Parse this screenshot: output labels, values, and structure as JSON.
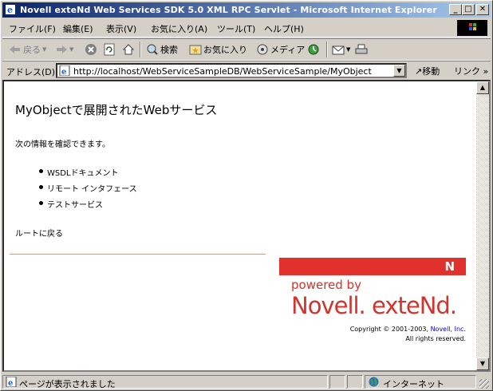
{
  "window": {
    "title": "Novell exteNd Web Services SDK 5.0 XML RPC Servlet - Microsoft Internet Explorer",
    "minimize_glyph": "_",
    "maximize_glyph": "□",
    "close_glyph": "✕"
  },
  "menu": {
    "items": [
      "ファイル(F)",
      "編集(E)",
      "表示(V)",
      "お気に入り(A)",
      "ツール(T)",
      "ヘルプ(H)"
    ]
  },
  "toolbar": {
    "back_label": "戻る",
    "search_label": "検索",
    "favorites_label": "お気に入り",
    "media_label": "メディア"
  },
  "address": {
    "label": "アドレス(D)",
    "url": "http://localhost/WebServiceSampleDB/WebServiceSample/MyObject",
    "go_label": "移動",
    "links_label": "リンク"
  },
  "page": {
    "heading": "MyObjectで展開されたWebサービス",
    "intro": "次の情報を確認できます。",
    "links": [
      "WSDLドキュメント",
      "リモート インタフェース",
      "テストサービス"
    ],
    "root_link": "ルートに戻る",
    "logo_letter": "N",
    "powered_by": "powered by",
    "brand": "Novell. exteNd.",
    "copyright_prefix": "Copyright © 2001-2003, ",
    "copyright_company": "Novell, Inc.",
    "rights": "All rights reserved."
  },
  "status": {
    "text": "ページが表示されました",
    "zone": "インターネット"
  },
  "colors": {
    "titlebar_start": "#0a246a",
    "titlebar_end": "#a6caf0",
    "brand_red": "#d0342c",
    "bar_red": "#e0312c"
  }
}
